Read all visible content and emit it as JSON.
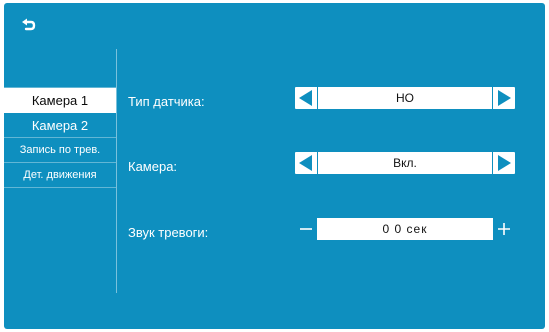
{
  "colors": {
    "background": "#0e8fbf",
    "panel": "#ffffff",
    "text_dark": "#111111"
  },
  "header": {
    "back_icon": "return-arrow-icon"
  },
  "sidebar": {
    "items": [
      {
        "label": "Камера 1",
        "active": true
      },
      {
        "label": "Камера 2",
        "active": false
      },
      {
        "label": "Запись по трев.",
        "active": false
      },
      {
        "label": "Дет. движения",
        "active": false
      }
    ]
  },
  "settings": {
    "sensor_type": {
      "label": "Тип датчика:",
      "value": "НО"
    },
    "camera": {
      "label": "Камера:",
      "value": "Вкл."
    },
    "alarm_sound": {
      "label": "Звук тревоги:",
      "value": "0 0  сек"
    }
  }
}
